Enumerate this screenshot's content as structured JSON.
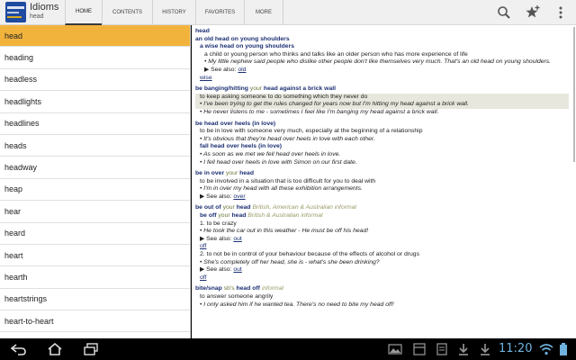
{
  "app": {
    "title": "Idioms",
    "subtitle": "head"
  },
  "tabs": [
    {
      "label": "HOME"
    },
    {
      "label": "CONTENTS"
    },
    {
      "label": "HISTORY"
    },
    {
      "label": "FAVORITES"
    },
    {
      "label": "MORE"
    }
  ],
  "list": {
    "items": [
      "head",
      "heading",
      "headless",
      "headlights",
      "headlines",
      "heads",
      "headway",
      "heap",
      "hear",
      "heard",
      "heart",
      "hearth",
      "heartstrings",
      "heart-to-heart"
    ],
    "selected": "head"
  },
  "detail": {
    "headword": "head",
    "e1": {
      "idiom": "an old head on young shoulders",
      "variant": "a wise head on young shoulders",
      "def": "a child or young person who thinks and talks like an older person who has more experience of life",
      "ex": "• My little nephew said people who dislike other people don't like themselves very much. That's an old head on young shoulders.",
      "see_label": "▶  See also:",
      "see": "old",
      "see2": "wise"
    },
    "e2": {
      "p1": "be banging/hitting ",
      "p2": "your",
      "p3": " head against a brick wall",
      "def": "to keep asking someone to do something which they never do",
      "ex1": "• I've been trying to get the rules changed for years now but I'm hitting my head against a brick wall.",
      "ex2": "• He never listens to me - sometimes I feel like I'm banging my head against a brick wall."
    },
    "e3": {
      "idiom": "be head over heels (in love)",
      "def": "to be in love with someone very much, especially at the beginning of a relationship",
      "ex1": "• It's obvious that they're head over heels in love with each other.",
      "variant": "fall head over heels (in love)",
      "ex2": "• As soon as we met we fell head over heels in love.",
      "ex3": "• I fell head over heels in love with Simon on our first date."
    },
    "e4": {
      "p1": "be in over ",
      "p2": "your",
      "p3": " head",
      "def": "to be involved in a situation that is too difficult for you to deal with",
      "ex": "• I'm in over my head with all these exhibition arrangements.",
      "see_label": "▶  See also:",
      "see": "over"
    },
    "e5": {
      "p1": "be out of ",
      "p2": "your",
      "p3": " head",
      "label": " British, American & Australian informal",
      "v1": "be off ",
      "v2": "your",
      "v3": " head",
      "vlabel": " British & Australian informal",
      "s1_def": "1.  to be crazy",
      "s1_ex": "• He took the car out in this weather - He must be off his head!",
      "see_label": "▶  See also:",
      "see1": "out",
      "see1b": "off",
      "s2_def": "2.  to not be in control of your behaviour because of the effects of alcohol or drugs",
      "s2_ex": "• She's completely off her head, she is - what's she been drinking?",
      "see2": "out",
      "see2b": "off"
    },
    "e6": {
      "p1": "bite/snap ",
      "p2": "sb's",
      "p3": " head off",
      "label": " informal",
      "def": "to answer someone angrily",
      "ex": "• I only asked him if he wanted tea. There's no need to bite my head off!"
    }
  },
  "system": {
    "time": "11:20"
  }
}
